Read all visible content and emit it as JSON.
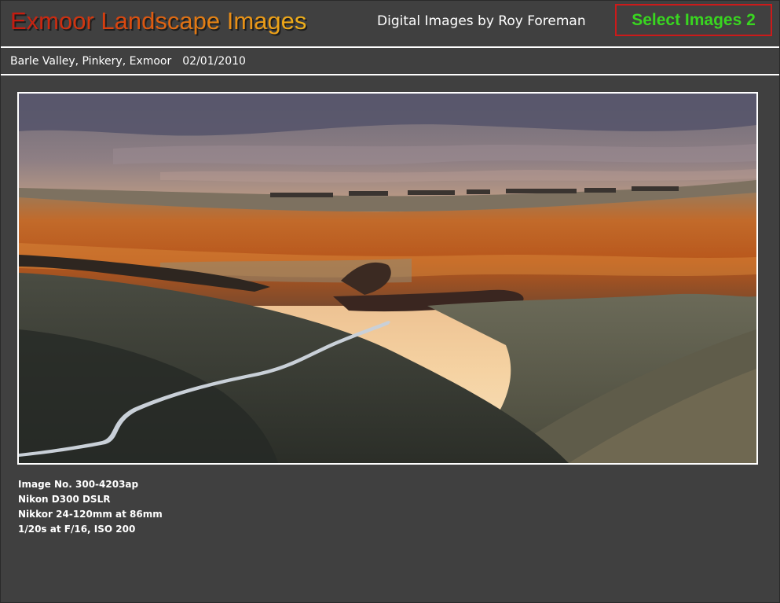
{
  "header": {
    "site_title": "Exmoor Landscape Images",
    "tagline": "Digital Images by Roy Foreman",
    "select_button_label": "Select Images 2"
  },
  "caption": {
    "location": "Barle Valley, Pinkery, Exmoor",
    "date": "02/01/2010"
  },
  "photo": {
    "alt": "Barle Valley, Pinkery, Exmoor"
  },
  "specs": [
    "Image No. 300-4203ap",
    "Nikon D300 DSLR",
    "Nikkor 24-120mm at 86mm",
    "1/20s at F/16, ISO 200"
  ],
  "colors": {
    "background": "#404040",
    "select_button_text": "#39d620",
    "select_button_border": "#cc1a1a",
    "title_gradient_start": "#c41a10",
    "title_gradient_end": "#f0b11a"
  }
}
